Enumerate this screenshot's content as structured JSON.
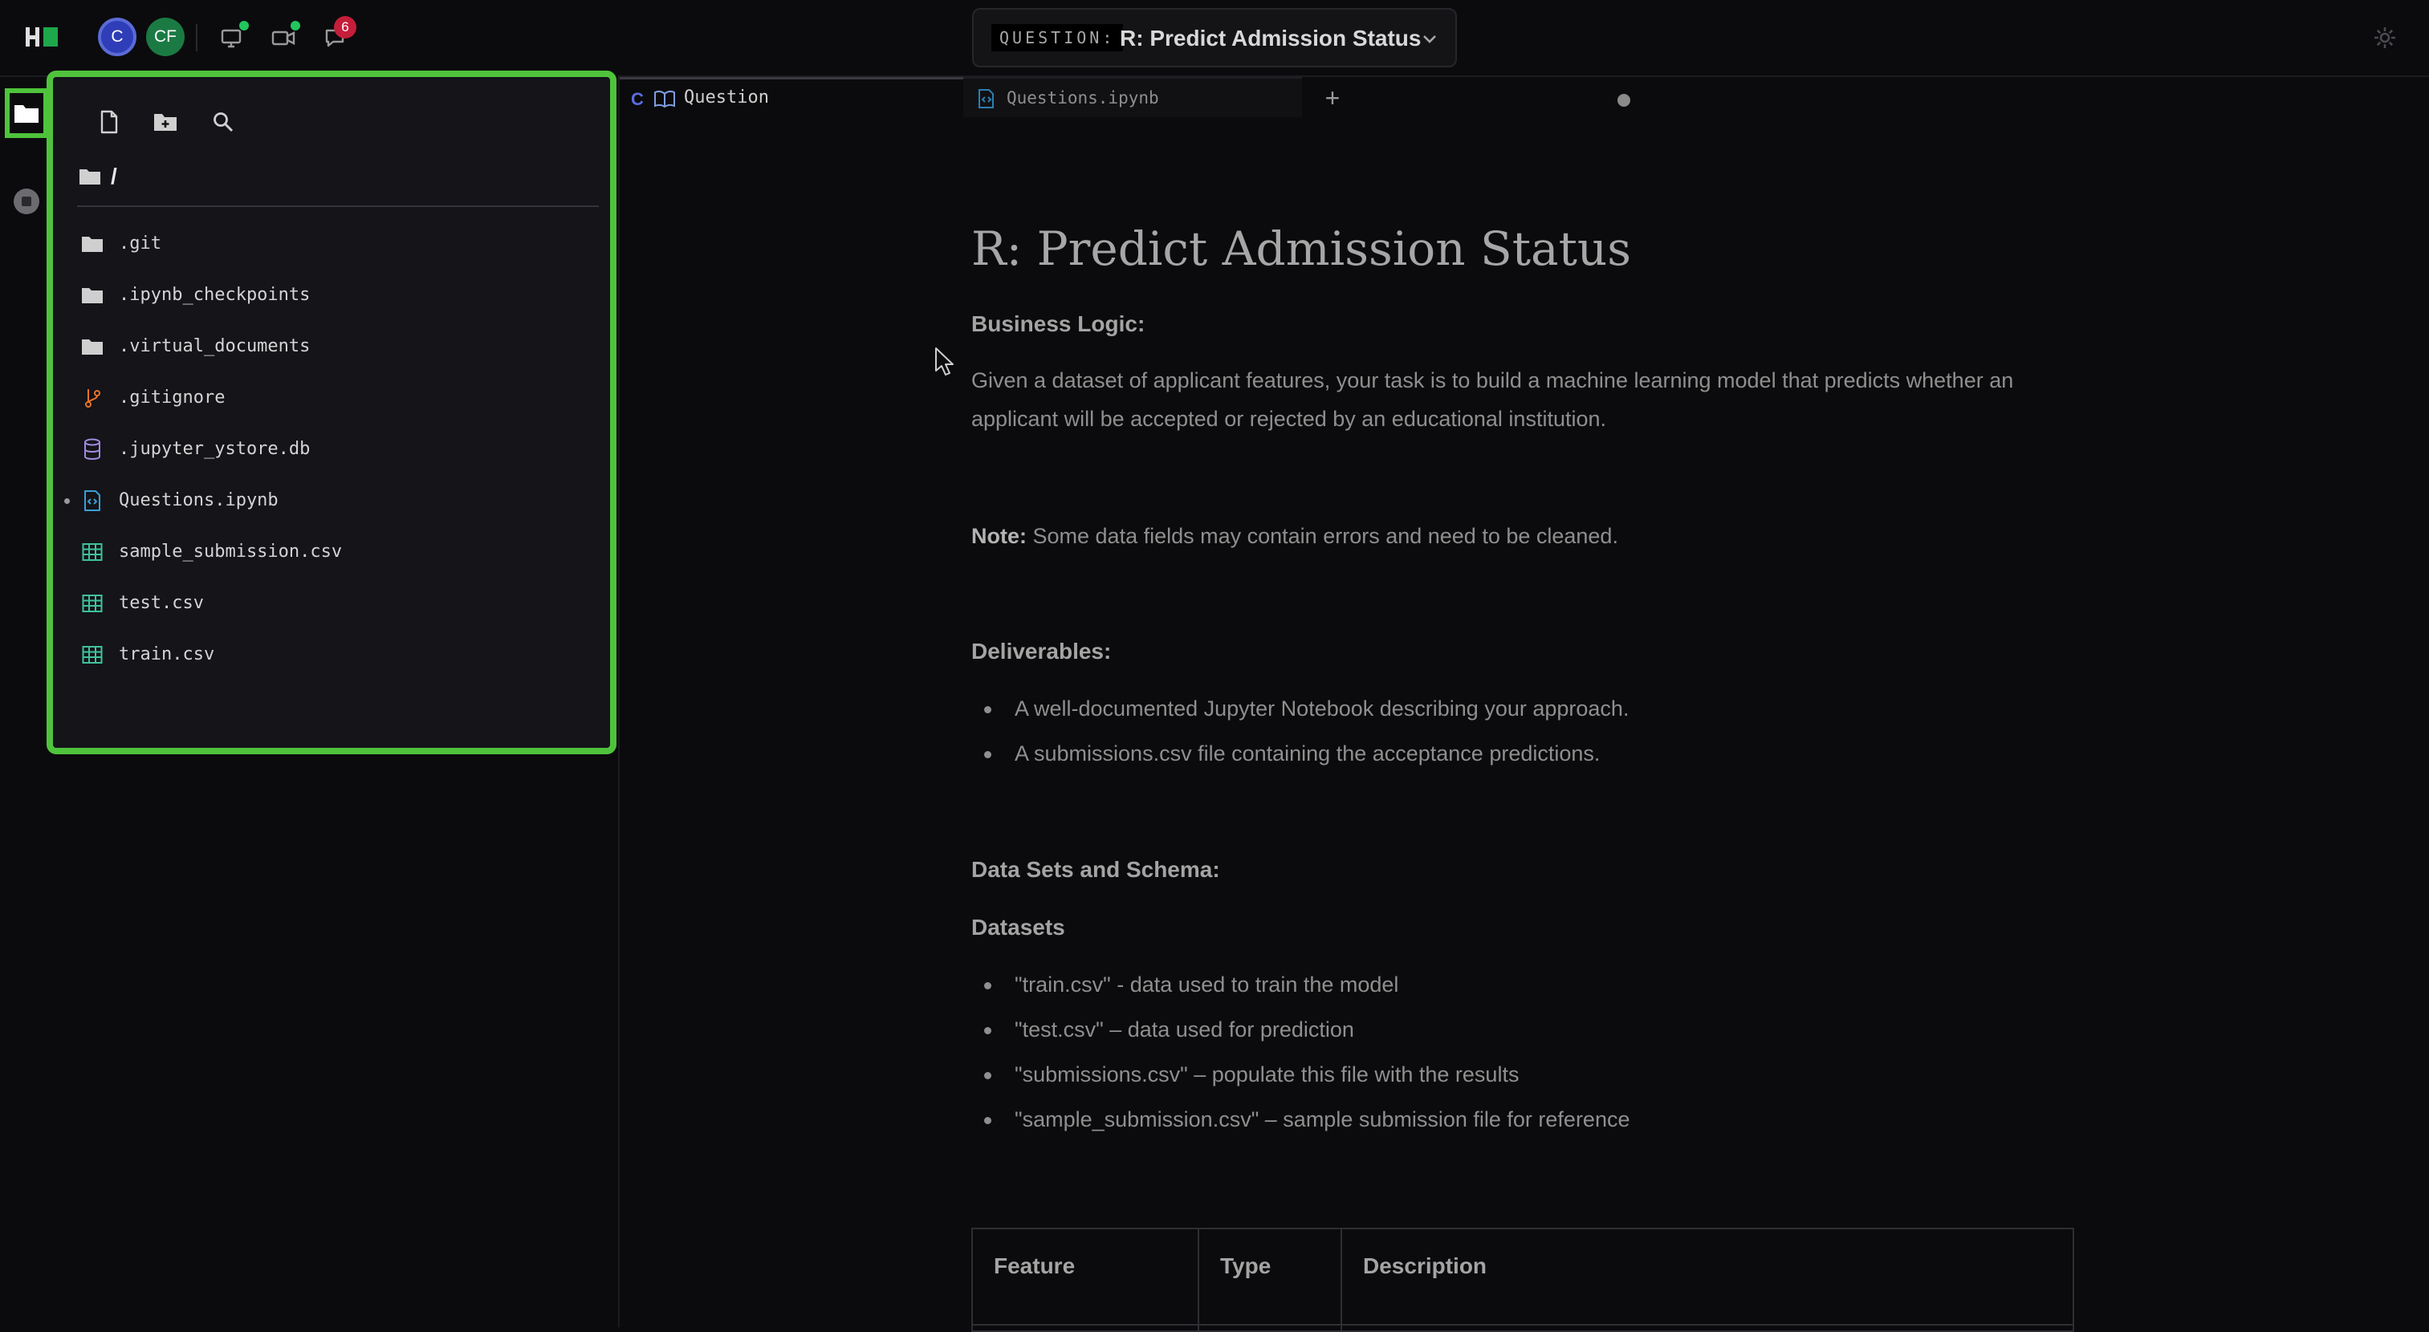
{
  "topbar": {
    "avatars": [
      {
        "initials": "C",
        "color": "#2f3db8"
      },
      {
        "initials": "CF",
        "color": "#1b7a44"
      }
    ],
    "notification_count": "6",
    "question_label": "QUESTION:",
    "question_title": "R: Predict Admission Status"
  },
  "explorer": {
    "path": "/",
    "files": [
      {
        "name": ".git",
        "icon": "folder-icon"
      },
      {
        "name": ".ipynb_checkpoints",
        "icon": "folder-icon"
      },
      {
        "name": ".virtual_documents",
        "icon": "folder-icon"
      },
      {
        "name": ".gitignore",
        "icon": "git-icon"
      },
      {
        "name": ".jupyter_ystore.db",
        "icon": "database-icon"
      },
      {
        "name": "Questions.ipynb",
        "icon": "notebook-icon"
      },
      {
        "name": "sample_submission.csv",
        "icon": "table-icon"
      },
      {
        "name": "test.csv",
        "icon": "table-icon"
      },
      {
        "name": "train.csv",
        "icon": "table-icon"
      }
    ]
  },
  "tabs": {
    "question": "Question",
    "notebook": "Questions.ipynb",
    "add": "+"
  },
  "doc": {
    "title": "R: Predict Admission Status",
    "business_logic_heading": "Business Logic:",
    "business_logic_text": "Given a dataset of applicant features, your task is to build a machine learning model that predicts whether an applicant will be accepted or rejected by an educational institution.",
    "note_label": "Note:",
    "note_text": " Some data fields may contain errors and need to be cleaned.",
    "deliverables_heading": "Deliverables:",
    "deliverables": [
      "A well-documented Jupyter Notebook describing your approach.",
      "A submissions.csv file containing the acceptance predictions."
    ],
    "datasets_schema_heading": "Data Sets and Schema:",
    "datasets_heading": "Datasets",
    "datasets": [
      "\"train.csv\" - data used to train the model",
      "\"test.csv\" – data used for prediction",
      "\"submissions.csv\" – populate this file with the results",
      "\"sample_submission.csv\" – sample submission file for reference"
    ],
    "table_headers": [
      "Feature",
      "Type",
      "Description"
    ]
  },
  "colors": {
    "accent_green": "#4fc33c",
    "badge_red": "#c41e3a",
    "background": "#0b0b0d"
  }
}
